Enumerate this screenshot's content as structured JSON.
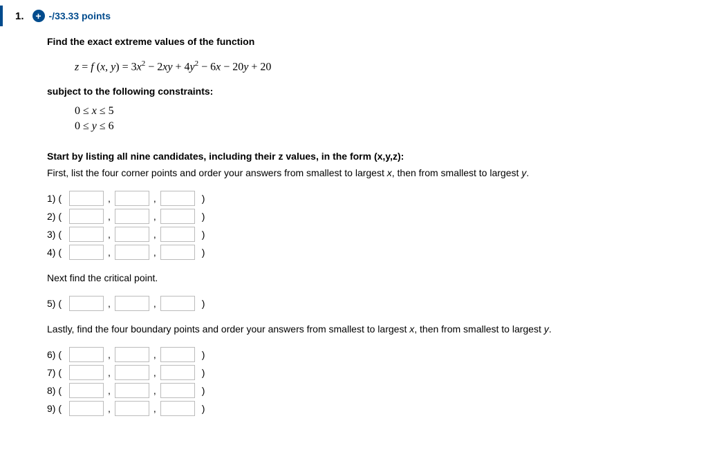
{
  "header": {
    "question_number": "1.",
    "points_text": "-/33.33 points"
  },
  "prompt": {
    "line1": "Find the exact extreme values of the function",
    "equation_plain": "z = f (x, y) = 3x² − 2xy + 4y² − 6x − 20y + 20",
    "line2": "subject to the following constraints:",
    "constraint1": "0 ≤ x ≤ 5",
    "constraint2": "0 ≤ y ≤ 6",
    "line3": "Start by listing all nine candidates, including their z values, in the form (x,y,z):",
    "line4": "First, list the four corner points and order your answers from smallest to largest x, then from smallest to largest y.",
    "rows_a": [
      "1) (",
      "2) (",
      "3) (",
      "4) ("
    ],
    "line5": "Next find the critical point.",
    "rows_b": [
      "5) ("
    ],
    "line6": "Lastly, find the four boundary points and order your answers from smallest to largest x, then from smallest to largest y.",
    "rows_c": [
      "6) (",
      "7) (",
      "8) (",
      "9) ("
    ]
  },
  "glyphs": {
    "comma": ",",
    "close_paren": ")",
    "plus": "+"
  }
}
